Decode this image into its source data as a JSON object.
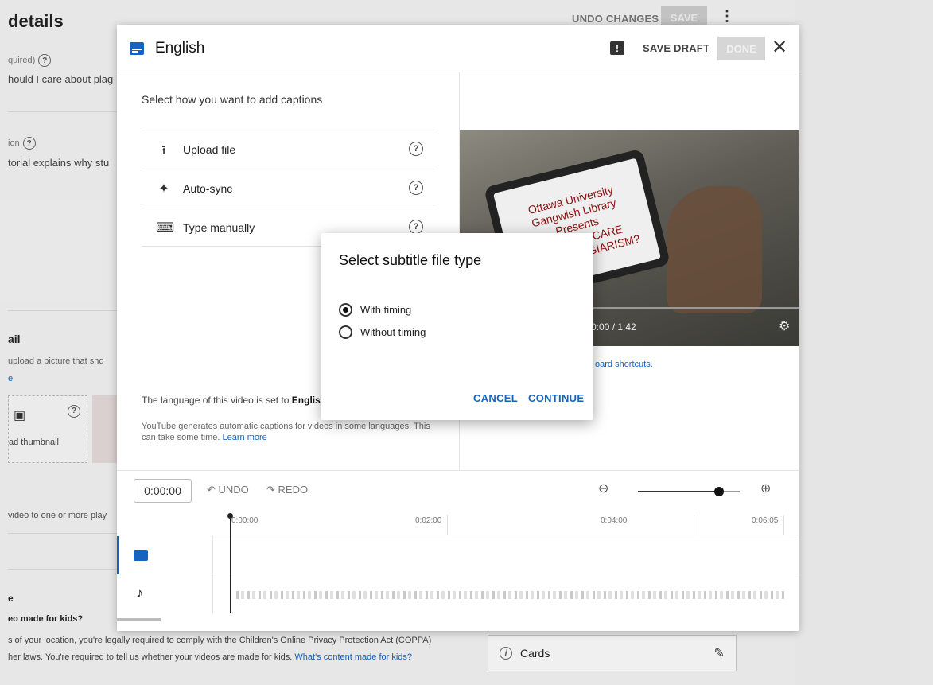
{
  "page": {
    "title": "details",
    "undo_changes": "UNDO CHANGES",
    "save": "SAVE",
    "kebab": "⋮",
    "title_label": "quired)",
    "title_value": "hould I care about plag",
    "desc_label": "ion",
    "desc_value": "torial explains why stu",
    "thumbnail_heading": "ail",
    "thumbnail_desc": "upload a picture that sho",
    "thumbnail_more": "e",
    "upload_thumbnail": "ad thumbnail",
    "playlist_desc": "video to one or more play",
    "audience_heading": "e",
    "made_for_kids_q": "eo made for kids?",
    "coppa_line1": "s of your location, you're legally required to comply with the Children's Online Privacy Protection Act (COPPA)",
    "coppa_line2": "her laws. You're required to tell us whether your videos are made for kids.",
    "coppa_link": "What's content made for kids?",
    "cards_label": "Cards"
  },
  "editor": {
    "title": "English",
    "save_draft": "SAVE DRAFT",
    "done": "DONE",
    "select_how": "Select how you want to add captions",
    "options": [
      {
        "label": "Upload file",
        "icon": "upload-icon"
      },
      {
        "label": "Auto-sync",
        "icon": "sparkle-icon"
      },
      {
        "label": "Type manually",
        "icon": "keyboard-icon"
      }
    ],
    "lang_note_prefix": "The language of this video is set to",
    "lang_note_lang": "English",
    "yt_note": "YouTube generates automatic captions for videos in some languages. This can take some time.",
    "learn_more": "Learn more",
    "video_text": [
      "Ottawa University",
      "Gangwish Library",
      "Presents",
      "SHOULD I CARE",
      "ABOUT PLAGIARISM?"
    ],
    "video_time": "0:00 / 1:42",
    "keyboard_shortcuts": "oard shortcuts.",
    "timecode": "0:00:00",
    "undo": "UNDO",
    "redo": "REDO",
    "ticks": [
      "0:00:00",
      "0:02:00",
      "0:04:00",
      "0:06:05"
    ]
  },
  "modal": {
    "title": "Select subtitle file type",
    "option_with": "With timing",
    "option_without": "Without timing",
    "selected": "With timing",
    "cancel": "CANCEL",
    "continue": "CONTINUE"
  },
  "colors": {
    "accent": "#1565c0"
  }
}
